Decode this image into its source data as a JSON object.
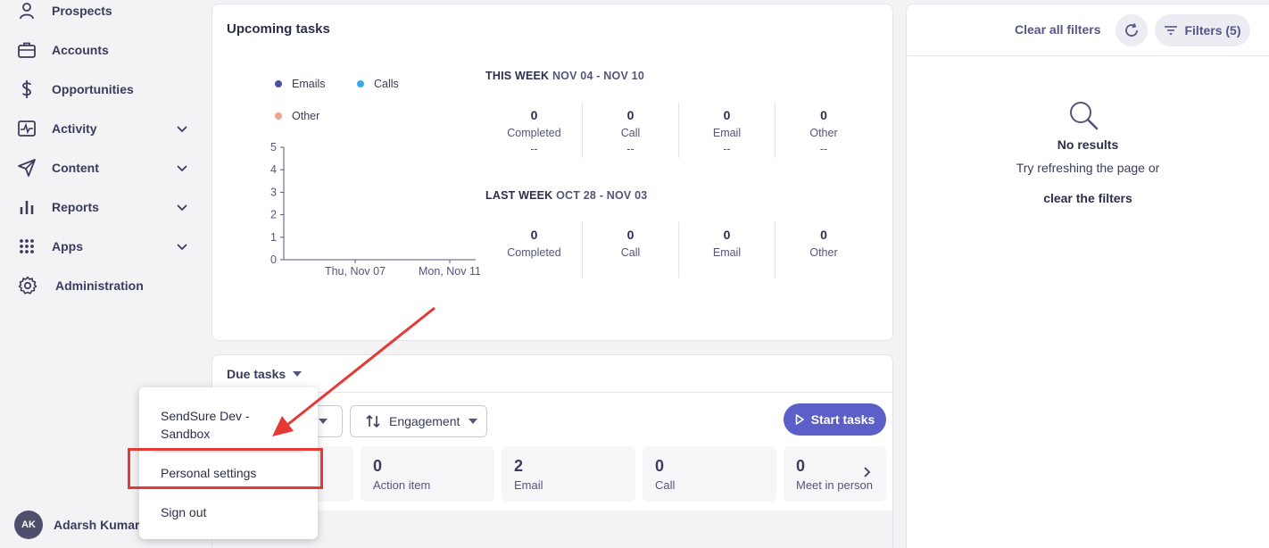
{
  "sidebar": {
    "items": [
      {
        "label": "Prospects",
        "icon": "person-icon",
        "has_chevron": false
      },
      {
        "label": "Accounts",
        "icon": "briefcase-icon",
        "has_chevron": false
      },
      {
        "label": "Opportunities",
        "icon": "dollar-icon",
        "has_chevron": false
      },
      {
        "label": "Activity",
        "icon": "pulse-icon",
        "has_chevron": true
      },
      {
        "label": "Content",
        "icon": "send-icon",
        "has_chevron": true
      },
      {
        "label": "Reports",
        "icon": "bar-chart-icon",
        "has_chevron": true
      },
      {
        "label": "Apps",
        "icon": "grid-dots-icon",
        "has_chevron": true
      },
      {
        "label": "Administration",
        "icon": "gear-icon",
        "has_chevron": false
      }
    ],
    "user": {
      "initials": "AK",
      "name": "Adarsh Kumar"
    }
  },
  "upcoming": {
    "title": "Upcoming tasks",
    "legend": [
      {
        "label": "Emails",
        "color": "#4a4f9e"
      },
      {
        "label": "Calls",
        "color": "#3aa8e8"
      },
      {
        "label": "Other",
        "color": "#f0a490"
      }
    ],
    "this_week": {
      "prefix": "THIS WEEK",
      "range": "NOV 04 - NOV 10",
      "stats": [
        {
          "value": "0",
          "label": "Completed",
          "sub": "--"
        },
        {
          "value": "0",
          "label": "Call",
          "sub": "--"
        },
        {
          "value": "0",
          "label": "Email",
          "sub": "--"
        },
        {
          "value": "0",
          "label": "Other",
          "sub": "--"
        }
      ]
    },
    "last_week": {
      "prefix": "LAST WEEK",
      "range": "OCT 28 - NOV 03",
      "stats": [
        {
          "value": "0",
          "label": "Completed"
        },
        {
          "value": "0",
          "label": "Call"
        },
        {
          "value": "0",
          "label": "Email"
        },
        {
          "value": "0",
          "label": "Other"
        }
      ]
    }
  },
  "chart_data": {
    "type": "line",
    "x": [
      "Thu, Nov 07",
      "Mon, Nov 11"
    ],
    "series": [
      {
        "name": "Emails",
        "values": [
          0,
          0
        ]
      },
      {
        "name": "Calls",
        "values": [
          0,
          0
        ]
      },
      {
        "name": "Other",
        "values": [
          0,
          0
        ]
      }
    ],
    "yticks": [
      "0",
      "1",
      "2",
      "3",
      "4",
      "5"
    ],
    "ylim": [
      0,
      5
    ],
    "legend": "top-left"
  },
  "due": {
    "title": "Due tasks",
    "sort_label": "Engagement",
    "start_label": "Start tasks",
    "tiles": [
      {
        "value": "0",
        "label": "Action item"
      },
      {
        "value": "2",
        "label": "Email"
      },
      {
        "value": "0",
        "label": "Call"
      },
      {
        "value": "0",
        "label": "Meet in person"
      }
    ]
  },
  "filters": {
    "clear_label": "Clear all filters",
    "filters_label": "Filters (5)",
    "empty_title": "No results",
    "empty_sub": "Try refreshing the page or",
    "empty_link": "clear the filters"
  },
  "popup": {
    "workspace_line1": "SendSure Dev -",
    "workspace_line2": "Sandbox",
    "personal_settings": "Personal settings",
    "sign_out": "Sign out"
  },
  "annotation_color": "#e53935"
}
